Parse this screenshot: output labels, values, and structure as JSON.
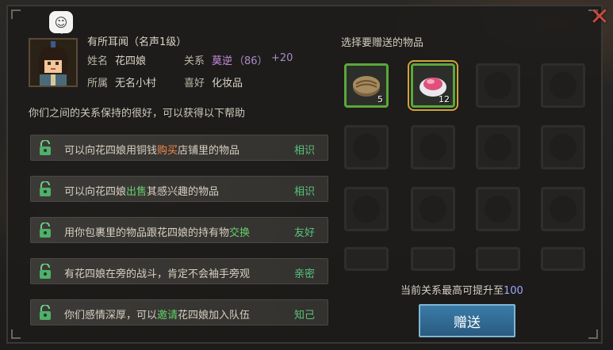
{
  "header": {
    "rank": "有所耳闻（名声1级）",
    "name_label": "姓名",
    "name_value": "花四娘",
    "relation_label": "关系",
    "relation_value": "莫逆",
    "relation_score": "（86）",
    "relation_bonus": "+20",
    "belong_label": "所属",
    "belong_value": "无名小村",
    "like_label": "喜好",
    "like_value": "化妆品"
  },
  "hint": "你们之间的关系保持的很好，可以获得以下帮助",
  "perks": [
    {
      "pre": "可以向花四娘用铜钱",
      "hl": "购买",
      "post": "店铺里的物品",
      "hl_color": "orange",
      "level": "相识"
    },
    {
      "pre": "可以向花四娘",
      "hl": "出售",
      "post": "其感兴趣的物品",
      "hl_color": "green",
      "level": "相识"
    },
    {
      "pre": "用你包裹里的物品跟花四娘的持有物",
      "hl": "交换",
      "post": "",
      "hl_color": "green",
      "level": "友好"
    },
    {
      "pre": "有花四娘在旁的战斗，肯定不会袖手旁观",
      "hl": "",
      "post": "",
      "hl_color": "green",
      "level": "亲密"
    },
    {
      "pre": "你们感情深厚，可以",
      "hl": "邀请",
      "post": "花四娘加入队伍",
      "hl_color": "green",
      "level": "知己"
    }
  ],
  "gift": {
    "title": "选择要赠送的物品",
    "items": [
      {
        "icon": "mooncake-icon",
        "count": "5"
      },
      {
        "icon": "pink-cream-icon",
        "count": "12"
      }
    ],
    "max_info_prefix": "当前关系最高可提升至",
    "max_info_value": "100",
    "button": "赠送"
  },
  "colors": {
    "accent_green": "#58c47a",
    "orange": "#f08a4b",
    "relation": "#c88be0"
  }
}
